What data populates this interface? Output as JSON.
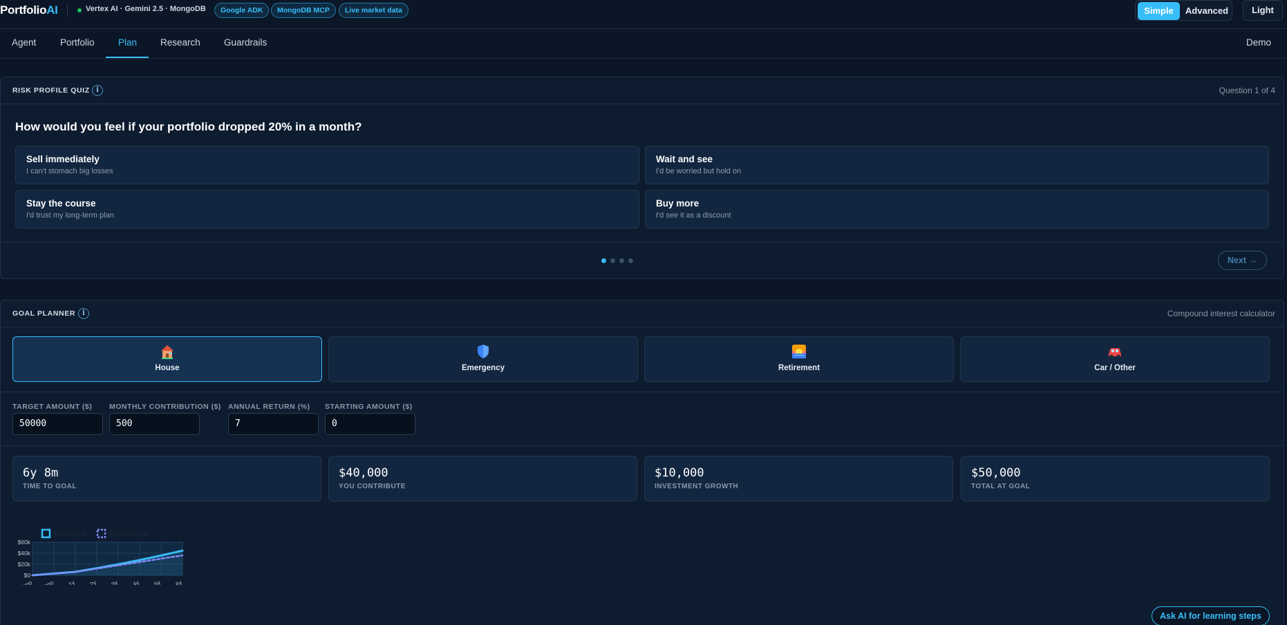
{
  "app": {
    "brand_main": "Portfolio",
    "brand_accent": "AI",
    "stack": "Vertex AI · Gemini 2.5 · MongoDB",
    "pills": [
      "Google ADK",
      "MongoDB MCP",
      "Live market data"
    ],
    "mode": {
      "simple": "Simple",
      "advanced": "Advanced",
      "selected": "Simple"
    },
    "theme_button": "Light",
    "accent_color": "#38bdf8"
  },
  "nav": {
    "tabs": [
      "Agent",
      "Portfolio",
      "Plan",
      "Research",
      "Guardrails"
    ],
    "active": "Plan",
    "right": "Demo"
  },
  "quiz": {
    "title": "RISK PROFILE QUIZ",
    "info_icon": "info-icon",
    "progress": "Question 1 of 4",
    "question": "How would you feel if your portfolio dropped 20% in a month?",
    "options": [
      {
        "title": "Sell immediately",
        "subtitle": "I can't stomach big losses"
      },
      {
        "title": "Wait and see",
        "subtitle": "I'd be worried but hold on"
      },
      {
        "title": "Stay the course",
        "subtitle": "I'd trust my long-term plan"
      },
      {
        "title": "Buy more",
        "subtitle": "I'd see it as a discount"
      }
    ],
    "step": 1,
    "total_steps": 4,
    "next_label": "Next →"
  },
  "goal_planner": {
    "title": "GOAL PLANNER",
    "info_icon": "info-icon",
    "subtitle": "Compound interest calculator",
    "goals": [
      {
        "label": "House",
        "icon": "house-icon"
      },
      {
        "label": "Emergency",
        "icon": "shield-icon"
      },
      {
        "label": "Retirement",
        "icon": "sunset-icon"
      },
      {
        "label": "Car / Other",
        "icon": "car-icon"
      }
    ],
    "selected_goal": "House",
    "fields": {
      "target_amount": {
        "label": "TARGET AMOUNT ($)",
        "value": "50000"
      },
      "monthly_contribution": {
        "label": "MONTHLY CONTRIBUTION ($)",
        "value": "500"
      },
      "annual_return": {
        "label": "ANNUAL RETURN (%)",
        "value": "7"
      },
      "starting_amount": {
        "label": "STARTING AMOUNT ($)",
        "value": "0"
      }
    },
    "stats": [
      {
        "value": "6y 8m",
        "label": "TIME TO GOAL"
      },
      {
        "value": "$40,000",
        "label": "YOU CONTRIBUTE"
      },
      {
        "value": "$10,000",
        "label": "INVESTMENT GROWTH"
      },
      {
        "value": "$50,000",
        "label": "TOTAL AT GOAL"
      }
    ],
    "ask_ai_label": "Ask AI for learning steps"
  },
  "chart_data": {
    "type": "line",
    "title": "",
    "xlabel": "",
    "ylabel": "",
    "x": [
      "0mo",
      "6mo",
      "1y",
      "2y",
      "3y",
      "4y",
      "5y",
      "6y"
    ],
    "y_ticks": [
      "$0",
      "$20k",
      "$40k",
      "$60k"
    ],
    "ylim": [
      0,
      60000
    ],
    "series": [
      {
        "name": "Total value",
        "color": "#38bdf8",
        "style": "solid",
        "values": [
          0,
          3100,
          6300,
          12900,
          19900,
          27600,
          35800,
          44600
        ]
      },
      {
        "name": "Contributions",
        "color": "#818cf8",
        "style": "dashed",
        "values": [
          0,
          3000,
          6000,
          12000,
          18000,
          24000,
          30000,
          36000
        ]
      }
    ],
    "grid": true,
    "legend": "top-left"
  }
}
